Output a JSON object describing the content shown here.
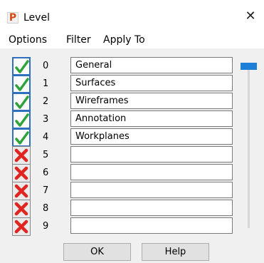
{
  "window": {
    "title": "Level",
    "app_icon_letter": "P",
    "close_glyph": "✕"
  },
  "menu": {
    "options": "Options",
    "filter": "Filter",
    "apply_to": "Apply To"
  },
  "levels": [
    {
      "number": "0",
      "name": "General",
      "active": true
    },
    {
      "number": "1",
      "name": "Surfaces",
      "active": true
    },
    {
      "number": "2",
      "name": "Wireframes",
      "active": true
    },
    {
      "number": "3",
      "name": "Annotation",
      "active": true
    },
    {
      "number": "4",
      "name": "Workplanes",
      "active": true
    },
    {
      "number": "5",
      "name": "",
      "active": false
    },
    {
      "number": "6",
      "name": "",
      "active": false
    },
    {
      "number": "7",
      "name": "",
      "active": false
    },
    {
      "number": "8",
      "name": "",
      "active": false
    },
    {
      "number": "9",
      "name": "",
      "active": false
    }
  ],
  "slider": {
    "position": 0
  },
  "buttons": {
    "ok": "OK",
    "help": "Help"
  },
  "colors": {
    "check_green": "#2ea33a",
    "cross_red": "#e0241f",
    "slider_blue": "#1e7fd8",
    "active_border": "#2e6fbe"
  },
  "icons": {
    "app": "p-app-icon",
    "close": "close-icon",
    "active": "green-check-icon",
    "inactive": "red-cross-icon"
  }
}
